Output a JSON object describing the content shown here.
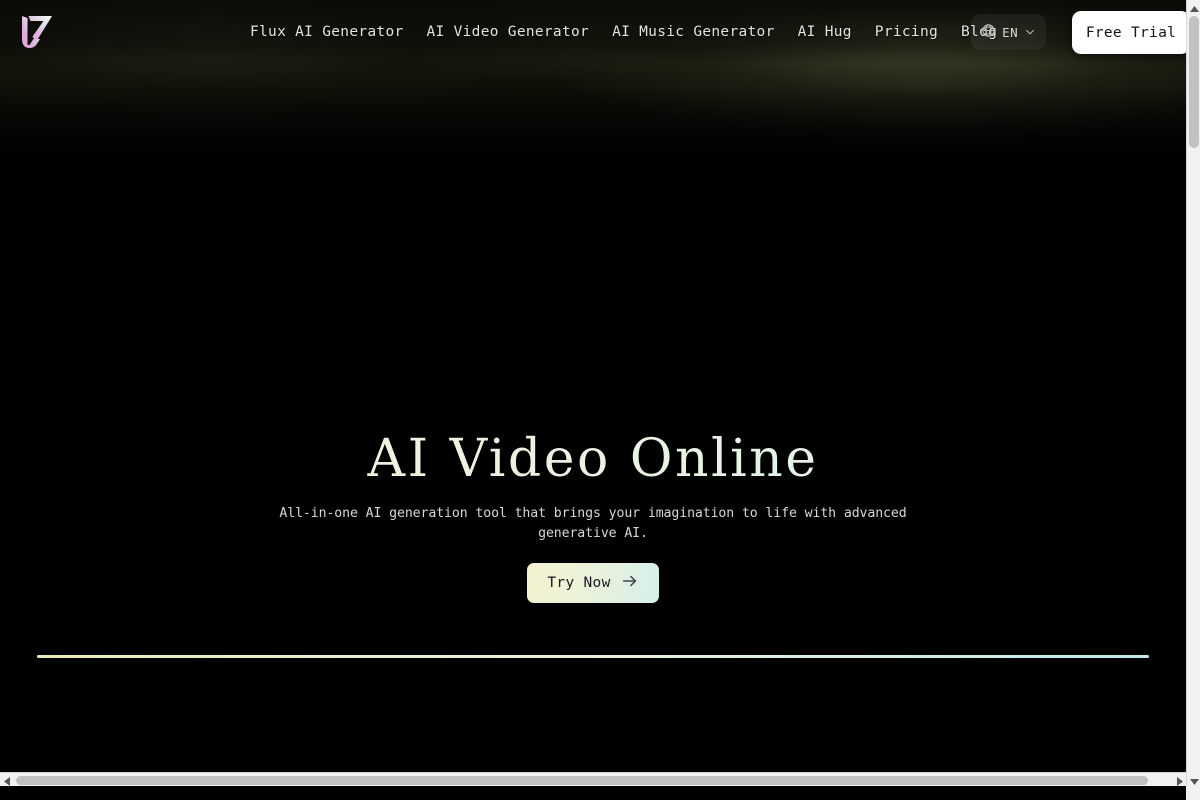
{
  "brand": {
    "logo_icon": "play-triangle-logo-icon",
    "gradient_from": "#e9a7d8",
    "gradient_to": "#f2f2f2"
  },
  "nav": {
    "items": [
      {
        "label": "Flux AI Generator"
      },
      {
        "label": "AI Video Generator"
      },
      {
        "label": "AI Music Generator"
      },
      {
        "label": "AI Hug"
      },
      {
        "label": "Pricing"
      },
      {
        "label": "Blog"
      }
    ]
  },
  "language": {
    "icon": "globe-icon",
    "code": "EN",
    "chevron": "chevron-down-icon"
  },
  "header": {
    "free_trial_label": "Free Trial"
  },
  "hero": {
    "title": "AI Video Online",
    "subtitle": "All-in-one AI generation tool that brings your imagination to life with advanced generative AI.",
    "cta_label": "Try Now",
    "cta_icon": "arrow-right-icon",
    "title_gradient_from": "#f3f3d2",
    "title_gradient_to": "#d6f1f0",
    "divider_gradient_from": "#e9e9b4",
    "divider_gradient_to": "#bfeaea"
  },
  "scrollbars": {
    "vertical_up_icon": "triangle-up-icon",
    "vertical_down_icon": "triangle-down-icon",
    "horizontal_left_icon": "triangle-left-icon",
    "horizontal_right_icon": "triangle-right-icon"
  }
}
